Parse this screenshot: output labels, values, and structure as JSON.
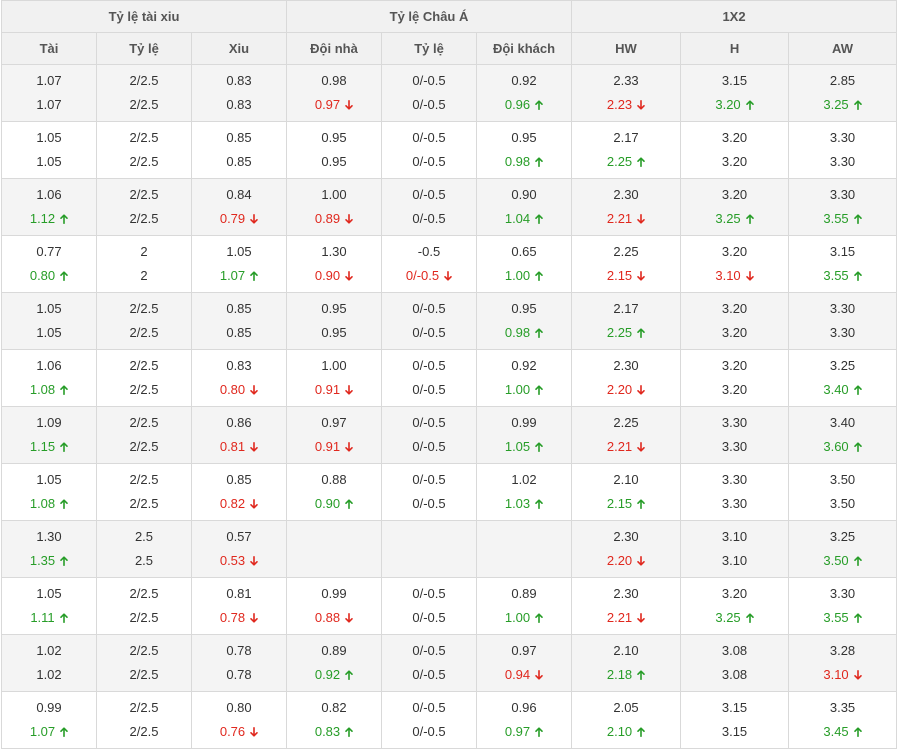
{
  "colors": {
    "up": "#279d28",
    "down": "#e0281e",
    "neutral": "#333333",
    "header_bg": "#f1f1f1",
    "alt_row_bg": "#f4f4f4"
  },
  "icons": {
    "up": "arrow-up-icon",
    "down": "arrow-down-icon"
  },
  "groups": [
    "Tỷ lệ tài xiu",
    "Tỷ lệ Châu Á",
    "1X2"
  ],
  "columns": [
    "Tài",
    "Tỷ lệ",
    "Xiu",
    "Đội nhà",
    "Tỷ lệ",
    "Đội khách",
    "HW",
    "H",
    "AW"
  ],
  "rows": [
    [
      [
        {
          "v": "1.07",
          "d": ""
        },
        {
          "v": "1.07",
          "d": ""
        }
      ],
      [
        {
          "v": "2/2.5",
          "d": ""
        },
        {
          "v": "2/2.5",
          "d": ""
        }
      ],
      [
        {
          "v": "0.83",
          "d": ""
        },
        {
          "v": "0.83",
          "d": ""
        }
      ],
      [
        {
          "v": "0.98",
          "d": ""
        },
        {
          "v": "0.97",
          "d": "down"
        }
      ],
      [
        {
          "v": "0/-0.5",
          "d": ""
        },
        {
          "v": "0/-0.5",
          "d": ""
        }
      ],
      [
        {
          "v": "0.92",
          "d": ""
        },
        {
          "v": "0.96",
          "d": "up"
        }
      ],
      [
        {
          "v": "2.33",
          "d": ""
        },
        {
          "v": "2.23",
          "d": "down"
        }
      ],
      [
        {
          "v": "3.15",
          "d": ""
        },
        {
          "v": "3.20",
          "d": "up"
        }
      ],
      [
        {
          "v": "2.85",
          "d": ""
        },
        {
          "v": "3.25",
          "d": "up"
        }
      ]
    ],
    [
      [
        {
          "v": "1.05",
          "d": ""
        },
        {
          "v": "1.05",
          "d": ""
        }
      ],
      [
        {
          "v": "2/2.5",
          "d": ""
        },
        {
          "v": "2/2.5",
          "d": ""
        }
      ],
      [
        {
          "v": "0.85",
          "d": ""
        },
        {
          "v": "0.85",
          "d": ""
        }
      ],
      [
        {
          "v": "0.95",
          "d": ""
        },
        {
          "v": "0.95",
          "d": ""
        }
      ],
      [
        {
          "v": "0/-0.5",
          "d": ""
        },
        {
          "v": "0/-0.5",
          "d": ""
        }
      ],
      [
        {
          "v": "0.95",
          "d": ""
        },
        {
          "v": "0.98",
          "d": "up"
        }
      ],
      [
        {
          "v": "2.17",
          "d": ""
        },
        {
          "v": "2.25",
          "d": "up"
        }
      ],
      [
        {
          "v": "3.20",
          "d": ""
        },
        {
          "v": "3.20",
          "d": ""
        }
      ],
      [
        {
          "v": "3.30",
          "d": ""
        },
        {
          "v": "3.30",
          "d": ""
        }
      ]
    ],
    [
      [
        {
          "v": "1.06",
          "d": ""
        },
        {
          "v": "1.12",
          "d": "up"
        }
      ],
      [
        {
          "v": "2/2.5",
          "d": ""
        },
        {
          "v": "2/2.5",
          "d": ""
        }
      ],
      [
        {
          "v": "0.84",
          "d": ""
        },
        {
          "v": "0.79",
          "d": "down"
        }
      ],
      [
        {
          "v": "1.00",
          "d": ""
        },
        {
          "v": "0.89",
          "d": "down"
        }
      ],
      [
        {
          "v": "0/-0.5",
          "d": ""
        },
        {
          "v": "0/-0.5",
          "d": ""
        }
      ],
      [
        {
          "v": "0.90",
          "d": ""
        },
        {
          "v": "1.04",
          "d": "up"
        }
      ],
      [
        {
          "v": "2.30",
          "d": ""
        },
        {
          "v": "2.21",
          "d": "down"
        }
      ],
      [
        {
          "v": "3.20",
          "d": ""
        },
        {
          "v": "3.25",
          "d": "up"
        }
      ],
      [
        {
          "v": "3.30",
          "d": ""
        },
        {
          "v": "3.55",
          "d": "up"
        }
      ]
    ],
    [
      [
        {
          "v": "0.77",
          "d": ""
        },
        {
          "v": "0.80",
          "d": "up"
        }
      ],
      [
        {
          "v": "2",
          "d": ""
        },
        {
          "v": "2",
          "d": ""
        }
      ],
      [
        {
          "v": "1.05",
          "d": ""
        },
        {
          "v": "1.07",
          "d": "up"
        }
      ],
      [
        {
          "v": "1.30",
          "d": ""
        },
        {
          "v": "0.90",
          "d": "down"
        }
      ],
      [
        {
          "v": "-0.5",
          "d": ""
        },
        {
          "v": "0/-0.5",
          "d": "down"
        }
      ],
      [
        {
          "v": "0.65",
          "d": ""
        },
        {
          "v": "1.00",
          "d": "up"
        }
      ],
      [
        {
          "v": "2.25",
          "d": ""
        },
        {
          "v": "2.15",
          "d": "down"
        }
      ],
      [
        {
          "v": "3.20",
          "d": ""
        },
        {
          "v": "3.10",
          "d": "down"
        }
      ],
      [
        {
          "v": "3.15",
          "d": ""
        },
        {
          "v": "3.55",
          "d": "up"
        }
      ]
    ],
    [
      [
        {
          "v": "1.05",
          "d": ""
        },
        {
          "v": "1.05",
          "d": ""
        }
      ],
      [
        {
          "v": "2/2.5",
          "d": ""
        },
        {
          "v": "2/2.5",
          "d": ""
        }
      ],
      [
        {
          "v": "0.85",
          "d": ""
        },
        {
          "v": "0.85",
          "d": ""
        }
      ],
      [
        {
          "v": "0.95",
          "d": ""
        },
        {
          "v": "0.95",
          "d": ""
        }
      ],
      [
        {
          "v": "0/-0.5",
          "d": ""
        },
        {
          "v": "0/-0.5",
          "d": ""
        }
      ],
      [
        {
          "v": "0.95",
          "d": ""
        },
        {
          "v": "0.98",
          "d": "up"
        }
      ],
      [
        {
          "v": "2.17",
          "d": ""
        },
        {
          "v": "2.25",
          "d": "up"
        }
      ],
      [
        {
          "v": "3.20",
          "d": ""
        },
        {
          "v": "3.20",
          "d": ""
        }
      ],
      [
        {
          "v": "3.30",
          "d": ""
        },
        {
          "v": "3.30",
          "d": ""
        }
      ]
    ],
    [
      [
        {
          "v": "1.06",
          "d": ""
        },
        {
          "v": "1.08",
          "d": "up"
        }
      ],
      [
        {
          "v": "2/2.5",
          "d": ""
        },
        {
          "v": "2/2.5",
          "d": ""
        }
      ],
      [
        {
          "v": "0.83",
          "d": ""
        },
        {
          "v": "0.80",
          "d": "down"
        }
      ],
      [
        {
          "v": "1.00",
          "d": ""
        },
        {
          "v": "0.91",
          "d": "down"
        }
      ],
      [
        {
          "v": "0/-0.5",
          "d": ""
        },
        {
          "v": "0/-0.5",
          "d": ""
        }
      ],
      [
        {
          "v": "0.92",
          "d": ""
        },
        {
          "v": "1.00",
          "d": "up"
        }
      ],
      [
        {
          "v": "2.30",
          "d": ""
        },
        {
          "v": "2.20",
          "d": "down"
        }
      ],
      [
        {
          "v": "3.20",
          "d": ""
        },
        {
          "v": "3.20",
          "d": ""
        }
      ],
      [
        {
          "v": "3.25",
          "d": ""
        },
        {
          "v": "3.40",
          "d": "up"
        }
      ]
    ],
    [
      [
        {
          "v": "1.09",
          "d": ""
        },
        {
          "v": "1.15",
          "d": "up"
        }
      ],
      [
        {
          "v": "2/2.5",
          "d": ""
        },
        {
          "v": "2/2.5",
          "d": ""
        }
      ],
      [
        {
          "v": "0.86",
          "d": ""
        },
        {
          "v": "0.81",
          "d": "down"
        }
      ],
      [
        {
          "v": "0.97",
          "d": ""
        },
        {
          "v": "0.91",
          "d": "down"
        }
      ],
      [
        {
          "v": "0/-0.5",
          "d": ""
        },
        {
          "v": "0/-0.5",
          "d": ""
        }
      ],
      [
        {
          "v": "0.99",
          "d": ""
        },
        {
          "v": "1.05",
          "d": "up"
        }
      ],
      [
        {
          "v": "2.25",
          "d": ""
        },
        {
          "v": "2.21",
          "d": "down"
        }
      ],
      [
        {
          "v": "3.30",
          "d": ""
        },
        {
          "v": "3.30",
          "d": ""
        }
      ],
      [
        {
          "v": "3.40",
          "d": ""
        },
        {
          "v": "3.60",
          "d": "up"
        }
      ]
    ],
    [
      [
        {
          "v": "1.05",
          "d": ""
        },
        {
          "v": "1.08",
          "d": "up"
        }
      ],
      [
        {
          "v": "2/2.5",
          "d": ""
        },
        {
          "v": "2/2.5",
          "d": ""
        }
      ],
      [
        {
          "v": "0.85",
          "d": ""
        },
        {
          "v": "0.82",
          "d": "down"
        }
      ],
      [
        {
          "v": "0.88",
          "d": ""
        },
        {
          "v": "0.90",
          "d": "up"
        }
      ],
      [
        {
          "v": "0/-0.5",
          "d": ""
        },
        {
          "v": "0/-0.5",
          "d": ""
        }
      ],
      [
        {
          "v": "1.02",
          "d": ""
        },
        {
          "v": "1.03",
          "d": "up"
        }
      ],
      [
        {
          "v": "2.10",
          "d": ""
        },
        {
          "v": "2.15",
          "d": "up"
        }
      ],
      [
        {
          "v": "3.30",
          "d": ""
        },
        {
          "v": "3.30",
          "d": ""
        }
      ],
      [
        {
          "v": "3.50",
          "d": ""
        },
        {
          "v": "3.50",
          "d": ""
        }
      ]
    ],
    [
      [
        {
          "v": "1.30",
          "d": ""
        },
        {
          "v": "1.35",
          "d": "up"
        }
      ],
      [
        {
          "v": "2.5",
          "d": ""
        },
        {
          "v": "2.5",
          "d": ""
        }
      ],
      [
        {
          "v": "0.57",
          "d": ""
        },
        {
          "v": "0.53",
          "d": "down"
        }
      ],
      [],
      [],
      [],
      [
        {
          "v": "2.30",
          "d": ""
        },
        {
          "v": "2.20",
          "d": "down"
        }
      ],
      [
        {
          "v": "3.10",
          "d": ""
        },
        {
          "v": "3.10",
          "d": ""
        }
      ],
      [
        {
          "v": "3.25",
          "d": ""
        },
        {
          "v": "3.50",
          "d": "up"
        }
      ]
    ],
    [
      [
        {
          "v": "1.05",
          "d": ""
        },
        {
          "v": "1.11",
          "d": "up"
        }
      ],
      [
        {
          "v": "2/2.5",
          "d": ""
        },
        {
          "v": "2/2.5",
          "d": ""
        }
      ],
      [
        {
          "v": "0.81",
          "d": ""
        },
        {
          "v": "0.78",
          "d": "down"
        }
      ],
      [
        {
          "v": "0.99",
          "d": ""
        },
        {
          "v": "0.88",
          "d": "down"
        }
      ],
      [
        {
          "v": "0/-0.5",
          "d": ""
        },
        {
          "v": "0/-0.5",
          "d": ""
        }
      ],
      [
        {
          "v": "0.89",
          "d": ""
        },
        {
          "v": "1.00",
          "d": "up"
        }
      ],
      [
        {
          "v": "2.30",
          "d": ""
        },
        {
          "v": "2.21",
          "d": "down"
        }
      ],
      [
        {
          "v": "3.20",
          "d": ""
        },
        {
          "v": "3.25",
          "d": "up"
        }
      ],
      [
        {
          "v": "3.30",
          "d": ""
        },
        {
          "v": "3.55",
          "d": "up"
        }
      ]
    ],
    [
      [
        {
          "v": "1.02",
          "d": ""
        },
        {
          "v": "1.02",
          "d": ""
        }
      ],
      [
        {
          "v": "2/2.5",
          "d": ""
        },
        {
          "v": "2/2.5",
          "d": ""
        }
      ],
      [
        {
          "v": "0.78",
          "d": ""
        },
        {
          "v": "0.78",
          "d": ""
        }
      ],
      [
        {
          "v": "0.89",
          "d": ""
        },
        {
          "v": "0.92",
          "d": "up"
        }
      ],
      [
        {
          "v": "0/-0.5",
          "d": ""
        },
        {
          "v": "0/-0.5",
          "d": ""
        }
      ],
      [
        {
          "v": "0.97",
          "d": ""
        },
        {
          "v": "0.94",
          "d": "down"
        }
      ],
      [
        {
          "v": "2.10",
          "d": ""
        },
        {
          "v": "2.18",
          "d": "up"
        }
      ],
      [
        {
          "v": "3.08",
          "d": ""
        },
        {
          "v": "3.08",
          "d": ""
        }
      ],
      [
        {
          "v": "3.28",
          "d": ""
        },
        {
          "v": "3.10",
          "d": "down"
        }
      ]
    ],
    [
      [
        {
          "v": "0.99",
          "d": ""
        },
        {
          "v": "1.07",
          "d": "up"
        }
      ],
      [
        {
          "v": "2/2.5",
          "d": ""
        },
        {
          "v": "2/2.5",
          "d": ""
        }
      ],
      [
        {
          "v": "0.80",
          "d": ""
        },
        {
          "v": "0.76",
          "d": "down"
        }
      ],
      [
        {
          "v": "0.82",
          "d": ""
        },
        {
          "v": "0.83",
          "d": "up"
        }
      ],
      [
        {
          "v": "0/-0.5",
          "d": ""
        },
        {
          "v": "0/-0.5",
          "d": ""
        }
      ],
      [
        {
          "v": "0.96",
          "d": ""
        },
        {
          "v": "0.97",
          "d": "up"
        }
      ],
      [
        {
          "v": "2.05",
          "d": ""
        },
        {
          "v": "2.10",
          "d": "up"
        }
      ],
      [
        {
          "v": "3.15",
          "d": ""
        },
        {
          "v": "3.15",
          "d": ""
        }
      ],
      [
        {
          "v": "3.35",
          "d": ""
        },
        {
          "v": "3.45",
          "d": "up"
        }
      ]
    ]
  ]
}
